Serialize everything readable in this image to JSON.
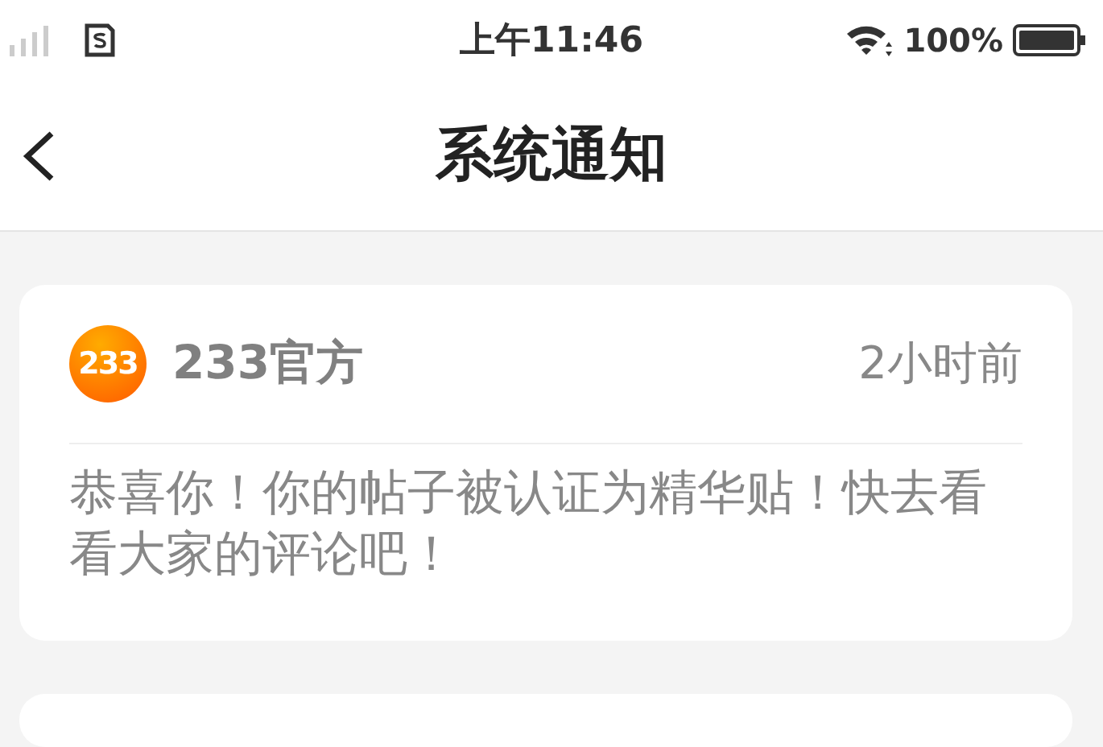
{
  "status_bar": {
    "time": "上午11:46",
    "battery": "100%"
  },
  "header": {
    "title": "系统通知"
  },
  "notices": [
    {
      "avatar_text": "233",
      "sender": "233官方",
      "time": "2小时前",
      "message": "恭喜你！你的帖子被认证为精华贴！快去看看大家的评论吧！"
    }
  ],
  "next_card_visible": true
}
